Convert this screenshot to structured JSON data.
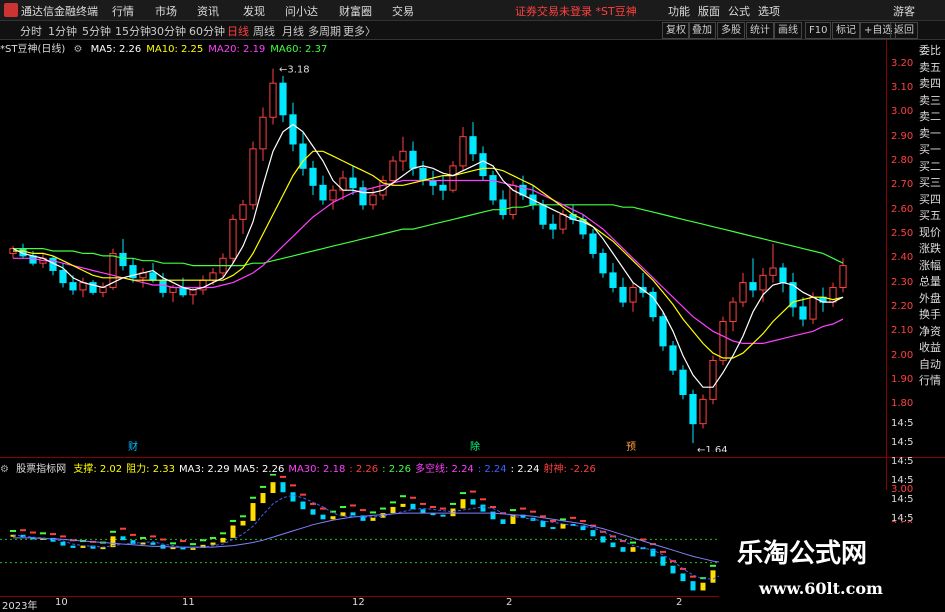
{
  "app": {
    "name": "通达信金融终端",
    "notice": "证券交易未登录 *ST豆神"
  },
  "menu": [
    "行情",
    "市场",
    "资讯",
    "发现",
    "问小达",
    "财富圈",
    "交易"
  ],
  "right_menu": [
    "功能",
    "版面",
    "公式",
    "选项",
    "游客"
  ],
  "periods": [
    "分时",
    "1分钟",
    "5分钟",
    "15分钟",
    "30分钟",
    "60分钟",
    "日线",
    "周线",
    "月线",
    "多周期",
    "更多〉"
  ],
  "active_period": "日线",
  "tools": [
    "复权",
    "叠加",
    "多股",
    "统计",
    "画线",
    "F10",
    "标记",
    "+自选",
    "返回"
  ],
  "main_header": {
    "title": "*ST豆神(日线)",
    "ma": [
      {
        "label": "MA5: 2.26",
        "color": "#ffffff"
      },
      {
        "label": "MA10: 2.25",
        "color": "#ffff00"
      },
      {
        "label": "MA20: 2.19",
        "color": "#ff40ff"
      },
      {
        "label": "MA60: 2.37",
        "color": "#40ff40"
      }
    ]
  },
  "sub_header": {
    "title": "股票指标网",
    "items": [
      {
        "label": "支撑: 2.02",
        "color": "#ffff00"
      },
      {
        "label": "阻力: 2.33",
        "color": "#ffff00"
      },
      {
        "label": "MA3: 2.29",
        "color": "#ffffff"
      },
      {
        "label": "MA5: 2.26",
        "color": "#ffffff"
      },
      {
        "label": "MA30: 2.18",
        "color": "#ff40ff"
      },
      {
        "label": ": 2.26",
        "color": "#ff4040"
      },
      {
        "label": ": 2.26",
        "color": "#40ff40"
      },
      {
        "label": "多空线: 2.24",
        "color": "#ff40ff"
      },
      {
        "label": ": 2.24",
        "color": "#4060ff"
      },
      {
        "label": ": 2.24",
        "color": "#ffffff"
      },
      {
        "label": "射神: -2.26",
        "color": "#ff4040"
      }
    ]
  },
  "price_axis": [
    "3.20",
    "3.10",
    "3.00",
    "2.90",
    "2.80",
    "2.70",
    "2.60",
    "2.50",
    "2.40",
    "2.30",
    "2.20",
    "2.10",
    "2.00",
    "1.90",
    "1.80"
  ],
  "time_axis": [
    "14:5",
    "14:5",
    "14:5",
    "14:5",
    "14:5",
    "14:5",
    "14:5",
    "14:5",
    "14:5",
    "14:5"
  ],
  "sub_axis": [
    "3.00",
    "2.50"
  ],
  "side_panel": [
    "委比",
    "卖五",
    "卖四",
    "卖三",
    "卖二",
    "卖一",
    "买一",
    "买二",
    "买三",
    "买四",
    "买五",
    "现价",
    "涨跌",
    "涨幅",
    "总量",
    "外盘",
    "换手",
    "净资",
    "收益",
    "自动",
    "行情"
  ],
  "bottom_axis": [
    {
      "label": "2023年",
      "pos": 2
    },
    {
      "label": "10",
      "pos": 55
    },
    {
      "label": "11",
      "pos": 182
    },
    {
      "label": "12",
      "pos": 352
    },
    {
      "label": "2",
      "pos": 506
    },
    {
      "label": "2",
      "pos": 676
    }
  ],
  "annotations": {
    "high": "3.18",
    "low": "1.64"
  },
  "markers": [
    "财",
    "除",
    "预"
  ],
  "watermark": {
    "title": "乐淘公式网",
    "url": "www.60lt.com"
  },
  "colors": {
    "up": "#ff4040",
    "down": "#00e8ff",
    "ma5": "#ffffff",
    "ma10": "#ffff00",
    "ma20": "#ff40ff",
    "ma60": "#40ff40"
  },
  "chart_data": {
    "type": "candlestick",
    "yrange": [
      1.62,
      3.24
    ],
    "candles": [
      [
        2.42,
        2.45,
        2.4,
        2.44
      ],
      [
        2.44,
        2.46,
        2.4,
        2.41
      ],
      [
        2.41,
        2.43,
        2.37,
        2.38
      ],
      [
        2.38,
        2.42,
        2.36,
        2.4
      ],
      [
        2.4,
        2.41,
        2.33,
        2.35
      ],
      [
        2.35,
        2.38,
        2.28,
        2.3
      ],
      [
        2.3,
        2.33,
        2.25,
        2.27
      ],
      [
        2.27,
        2.32,
        2.24,
        2.3
      ],
      [
        2.3,
        2.31,
        2.25,
        2.26
      ],
      [
        2.26,
        2.3,
        2.24,
        2.28
      ],
      [
        2.28,
        2.44,
        2.27,
        2.42
      ],
      [
        2.42,
        2.48,
        2.35,
        2.37
      ],
      [
        2.37,
        2.4,
        2.3,
        2.32
      ],
      [
        2.32,
        2.36,
        2.28,
        2.34
      ],
      [
        2.34,
        2.38,
        2.3,
        2.31
      ],
      [
        2.31,
        2.34,
        2.24,
        2.26
      ],
      [
        2.26,
        2.29,
        2.22,
        2.28
      ],
      [
        2.28,
        2.32,
        2.24,
        2.25
      ],
      [
        2.25,
        2.28,
        2.21,
        2.27
      ],
      [
        2.27,
        2.33,
        2.25,
        2.31
      ],
      [
        2.31,
        2.36,
        2.29,
        2.34
      ],
      [
        2.34,
        2.42,
        2.32,
        2.4
      ],
      [
        2.4,
        2.58,
        2.38,
        2.56
      ],
      [
        2.56,
        2.64,
        2.5,
        2.62
      ],
      [
        2.62,
        2.88,
        2.6,
        2.85
      ],
      [
        2.85,
        3.02,
        2.8,
        2.98
      ],
      [
        2.98,
        3.18,
        2.95,
        3.12
      ],
      [
        3.12,
        3.15,
        2.96,
        2.99
      ],
      [
        2.99,
        3.04,
        2.84,
        2.87
      ],
      [
        2.87,
        2.92,
        2.74,
        2.77
      ],
      [
        2.77,
        2.8,
        2.66,
        2.7
      ],
      [
        2.7,
        2.74,
        2.62,
        2.64
      ],
      [
        2.64,
        2.7,
        2.6,
        2.68
      ],
      [
        2.68,
        2.76,
        2.64,
        2.73
      ],
      [
        2.73,
        2.78,
        2.66,
        2.69
      ],
      [
        2.69,
        2.72,
        2.6,
        2.62
      ],
      [
        2.62,
        2.69,
        2.6,
        2.66
      ],
      [
        2.66,
        2.74,
        2.64,
        2.72
      ],
      [
        2.72,
        2.82,
        2.7,
        2.8
      ],
      [
        2.8,
        2.9,
        2.76,
        2.84
      ],
      [
        2.84,
        2.88,
        2.74,
        2.77
      ],
      [
        2.77,
        2.8,
        2.7,
        2.72
      ],
      [
        2.72,
        2.76,
        2.66,
        2.7
      ],
      [
        2.7,
        2.74,
        2.64,
        2.68
      ],
      [
        2.68,
        2.8,
        2.67,
        2.78
      ],
      [
        2.78,
        2.94,
        2.76,
        2.9
      ],
      [
        2.9,
        2.96,
        2.8,
        2.83
      ],
      [
        2.83,
        2.86,
        2.72,
        2.74
      ],
      [
        2.74,
        2.76,
        2.62,
        2.64
      ],
      [
        2.64,
        2.68,
        2.56,
        2.58
      ],
      [
        2.58,
        2.72,
        2.56,
        2.7
      ],
      [
        2.7,
        2.74,
        2.64,
        2.66
      ],
      [
        2.66,
        2.7,
        2.6,
        2.62
      ],
      [
        2.62,
        2.64,
        2.52,
        2.54
      ],
      [
        2.54,
        2.58,
        2.48,
        2.52
      ],
      [
        2.52,
        2.6,
        2.5,
        2.58
      ],
      [
        2.58,
        2.62,
        2.54,
        2.56
      ],
      [
        2.56,
        2.58,
        2.48,
        2.5
      ],
      [
        2.5,
        2.52,
        2.4,
        2.42
      ],
      [
        2.42,
        2.44,
        2.32,
        2.34
      ],
      [
        2.34,
        2.38,
        2.26,
        2.28
      ],
      [
        2.28,
        2.32,
        2.2,
        2.22
      ],
      [
        2.22,
        2.3,
        2.18,
        2.28
      ],
      [
        2.28,
        2.34,
        2.24,
        2.26
      ],
      [
        2.26,
        2.28,
        2.14,
        2.16
      ],
      [
        2.16,
        2.18,
        2.02,
        2.04
      ],
      [
        2.04,
        2.06,
        1.92,
        1.94
      ],
      [
        1.94,
        1.96,
        1.82,
        1.84
      ],
      [
        1.84,
        1.86,
        1.64,
        1.72
      ],
      [
        1.72,
        1.84,
        1.7,
        1.82
      ],
      [
        1.82,
        2.0,
        1.8,
        1.98
      ],
      [
        1.98,
        2.16,
        1.96,
        2.14
      ],
      [
        2.14,
        2.24,
        2.1,
        2.22
      ],
      [
        2.22,
        2.34,
        2.2,
        2.3
      ],
      [
        2.3,
        2.4,
        2.24,
        2.27
      ],
      [
        2.27,
        2.36,
        2.22,
        2.33
      ],
      [
        2.33,
        2.46,
        2.3,
        2.36
      ],
      [
        2.36,
        2.38,
        2.26,
        2.3
      ],
      [
        2.3,
        2.34,
        2.16,
        2.2
      ],
      [
        2.2,
        2.24,
        2.12,
        2.15
      ],
      [
        2.15,
        2.26,
        2.13,
        2.24
      ],
      [
        2.24,
        2.28,
        2.18,
        2.22
      ],
      [
        2.22,
        2.3,
        2.2,
        2.28
      ],
      [
        2.28,
        2.4,
        2.26,
        2.37
      ]
    ],
    "ma5": [
      2.44,
      2.42,
      2.41,
      2.4,
      2.38,
      2.36,
      2.32,
      2.3,
      2.29,
      2.28,
      2.3,
      2.32,
      2.33,
      2.34,
      2.35,
      2.32,
      2.3,
      2.28,
      2.27,
      2.28,
      2.3,
      2.32,
      2.38,
      2.45,
      2.55,
      2.7,
      2.84,
      2.92,
      2.95,
      2.92,
      2.86,
      2.8,
      2.72,
      2.68,
      2.68,
      2.67,
      2.67,
      2.68,
      2.71,
      2.74,
      2.77,
      2.78,
      2.77,
      2.75,
      2.74,
      2.76,
      2.78,
      2.8,
      2.78,
      2.72,
      2.68,
      2.66,
      2.64,
      2.62,
      2.6,
      2.58,
      2.56,
      2.55,
      2.53,
      2.48,
      2.42,
      2.36,
      2.3,
      2.27,
      2.24,
      2.18,
      2.1,
      2.0,
      1.92,
      1.87,
      1.87,
      1.93,
      2.0,
      2.08,
      2.18,
      2.25,
      2.29,
      2.3,
      2.29,
      2.26,
      2.24,
      2.22,
      2.22,
      2.24
    ],
    "ma10": [
      2.43,
      2.43,
      2.42,
      2.42,
      2.41,
      2.39,
      2.37,
      2.35,
      2.33,
      2.32,
      2.32,
      2.32,
      2.31,
      2.31,
      2.31,
      2.31,
      2.31,
      2.31,
      2.31,
      2.31,
      2.31,
      2.31,
      2.33,
      2.36,
      2.42,
      2.5,
      2.58,
      2.66,
      2.74,
      2.8,
      2.84,
      2.84,
      2.82,
      2.8,
      2.78,
      2.76,
      2.74,
      2.71,
      2.7,
      2.7,
      2.71,
      2.72,
      2.73,
      2.74,
      2.74,
      2.75,
      2.76,
      2.77,
      2.77,
      2.76,
      2.74,
      2.72,
      2.7,
      2.67,
      2.64,
      2.61,
      2.58,
      2.56,
      2.53,
      2.5,
      2.47,
      2.43,
      2.39,
      2.35,
      2.31,
      2.26,
      2.21,
      2.15,
      2.1,
      2.05,
      2.01,
      1.99,
      1.99,
      2.01,
      2.05,
      2.09,
      2.14,
      2.18,
      2.22,
      2.23,
      2.24,
      2.24,
      2.23,
      2.24
    ],
    "ma20": [
      2.4,
      2.4,
      2.4,
      2.39,
      2.39,
      2.38,
      2.37,
      2.36,
      2.35,
      2.34,
      2.33,
      2.32,
      2.31,
      2.3,
      2.29,
      2.29,
      2.28,
      2.28,
      2.28,
      2.28,
      2.28,
      2.29,
      2.3,
      2.32,
      2.34,
      2.37,
      2.41,
      2.45,
      2.49,
      2.53,
      2.57,
      2.6,
      2.63,
      2.65,
      2.67,
      2.68,
      2.69,
      2.7,
      2.71,
      2.72,
      2.72,
      2.72,
      2.72,
      2.72,
      2.72,
      2.72,
      2.72,
      2.72,
      2.72,
      2.71,
      2.7,
      2.69,
      2.68,
      2.66,
      2.64,
      2.62,
      2.6,
      2.58,
      2.55,
      2.52,
      2.48,
      2.44,
      2.4,
      2.36,
      2.32,
      2.28,
      2.24,
      2.2,
      2.16,
      2.13,
      2.1,
      2.08,
      2.06,
      2.05,
      2.05,
      2.05,
      2.06,
      2.07,
      2.08,
      2.09,
      2.1,
      2.12,
      2.13,
      2.15
    ],
    "ma60": [
      2.44,
      2.44,
      2.44,
      2.44,
      2.43,
      2.43,
      2.43,
      2.42,
      2.42,
      2.41,
      2.41,
      2.4,
      2.4,
      2.39,
      2.39,
      2.38,
      2.38,
      2.38,
      2.37,
      2.37,
      2.37,
      2.37,
      2.37,
      2.37,
      2.38,
      2.38,
      2.39,
      2.4,
      2.41,
      2.42,
      2.43,
      2.44,
      2.45,
      2.46,
      2.47,
      2.48,
      2.49,
      2.5,
      2.51,
      2.52,
      2.52,
      2.53,
      2.54,
      2.55,
      2.56,
      2.57,
      2.58,
      2.59,
      2.6,
      2.6,
      2.61,
      2.61,
      2.62,
      2.62,
      2.62,
      2.62,
      2.62,
      2.62,
      2.62,
      2.62,
      2.62,
      2.61,
      2.61,
      2.6,
      2.59,
      2.58,
      2.57,
      2.56,
      2.55,
      2.54,
      2.53,
      2.52,
      2.51,
      2.5,
      2.49,
      2.48,
      2.47,
      2.46,
      2.45,
      2.44,
      2.43,
      2.42,
      2.4,
      2.38
    ]
  }
}
